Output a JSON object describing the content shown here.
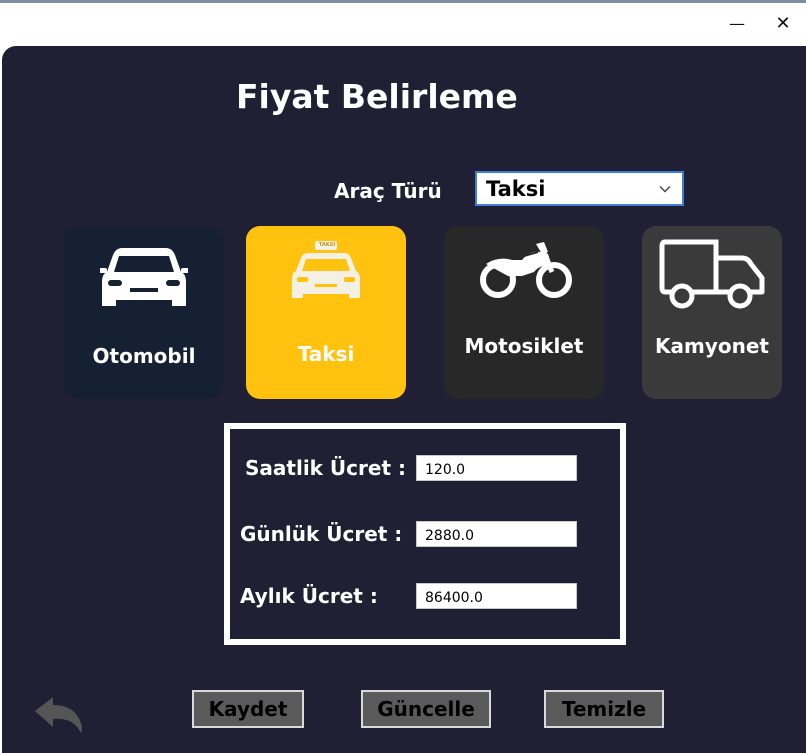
{
  "window": {
    "minimize_glyph": "—",
    "close_glyph": "✕"
  },
  "page": {
    "title": "Fiyat Belirleme"
  },
  "vehicle_type": {
    "label": "Araç Türü",
    "selected": "Taksi"
  },
  "cards": {
    "car": {
      "label": "Otomobil",
      "icon": "car-icon"
    },
    "taxi": {
      "label": "Taksi",
      "icon": "taxi-icon",
      "sign_text": "TAKSİ"
    },
    "motorcycle": {
      "label": "Motosiklet",
      "icon": "motorcycle-icon"
    },
    "truck": {
      "label": "Kamyonet",
      "icon": "truck-icon"
    }
  },
  "fees": {
    "hourly_label": "Saatlik Ücret :",
    "hourly_value": "120.0",
    "daily_label": "Günlük Ücret :",
    "daily_value": "2880.0",
    "monthly_label": "Aylık Ücret :",
    "monthly_value": "86400.0"
  },
  "actions": {
    "save": "Kaydet",
    "update": "Güncelle",
    "clear": "Temizle"
  },
  "colors": {
    "panel": "#201f33",
    "selected_card": "#ffc20e",
    "car_card": "#162033",
    "motorcycle_card": "#282828",
    "truck_card": "#3a3a3a",
    "button": "#5a5a5a"
  }
}
